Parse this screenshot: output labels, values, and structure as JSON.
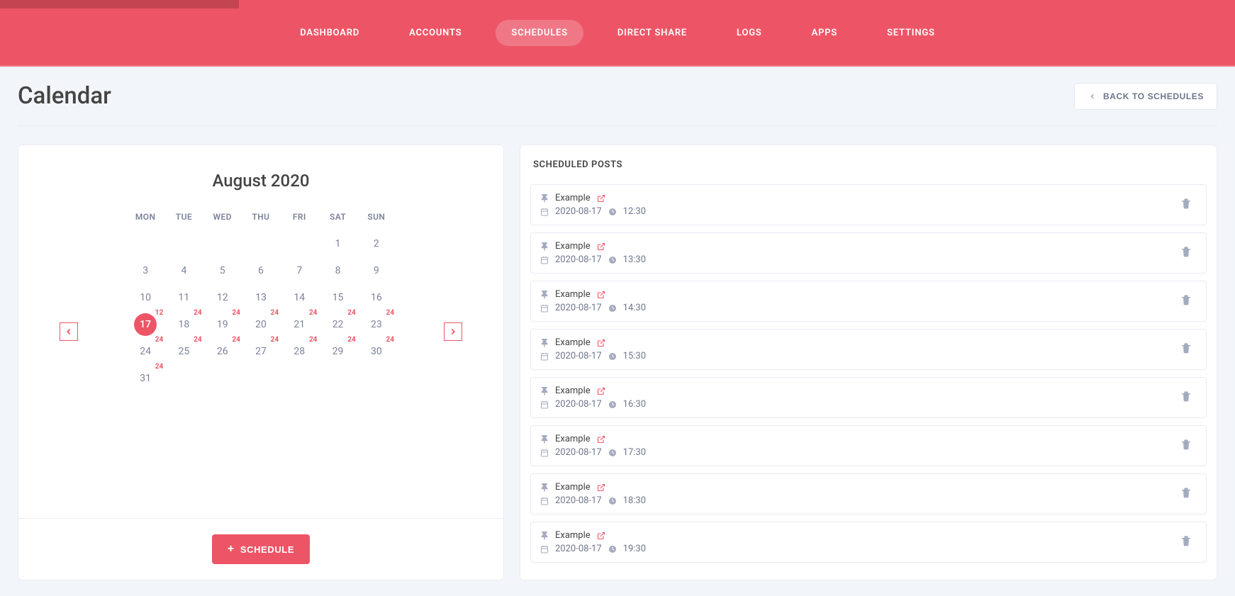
{
  "nav": {
    "items": [
      {
        "label": "DASHBOARD"
      },
      {
        "label": "ACCOUNTS"
      },
      {
        "label": "SCHEDULES",
        "active": true
      },
      {
        "label": "DIRECT SHARE"
      },
      {
        "label": "LOGS"
      },
      {
        "label": "APPS"
      },
      {
        "label": "SETTINGS"
      }
    ]
  },
  "page": {
    "title": "Calendar",
    "back_label": "BACK TO SCHEDULES"
  },
  "calendar": {
    "month_label": "August 2020",
    "dow": [
      "MON",
      "TUE",
      "WED",
      "THU",
      "FRI",
      "SAT",
      "SUN"
    ],
    "weeks": [
      [
        null,
        null,
        null,
        null,
        null,
        {
          "n": "1"
        },
        {
          "n": "2"
        }
      ],
      [
        {
          "n": "3"
        },
        {
          "n": "4"
        },
        {
          "n": "5"
        },
        {
          "n": "6"
        },
        {
          "n": "7"
        },
        {
          "n": "8"
        },
        {
          "n": "9"
        }
      ],
      [
        {
          "n": "10"
        },
        {
          "n": "11"
        },
        {
          "n": "12"
        },
        {
          "n": "13"
        },
        {
          "n": "14"
        },
        {
          "n": "15"
        },
        {
          "n": "16"
        }
      ],
      [
        {
          "n": "17",
          "sel": true,
          "b": "12"
        },
        {
          "n": "18",
          "b": "24"
        },
        {
          "n": "19",
          "b": "24"
        },
        {
          "n": "20",
          "b": "24"
        },
        {
          "n": "21",
          "b": "24"
        },
        {
          "n": "22",
          "b": "24"
        },
        {
          "n": "23",
          "b": "24"
        }
      ],
      [
        {
          "n": "24",
          "b": "24"
        },
        {
          "n": "25",
          "b": "24"
        },
        {
          "n": "26",
          "b": "24"
        },
        {
          "n": "27",
          "b": "24"
        },
        {
          "n": "28",
          "b": "24"
        },
        {
          "n": "29",
          "b": "24"
        },
        {
          "n": "30",
          "b": "24"
        }
      ],
      [
        {
          "n": "31",
          "b": "24"
        },
        null,
        null,
        null,
        null,
        null,
        null
      ]
    ],
    "schedule_btn": "SCHEDULE"
  },
  "posts": {
    "header": "SCHEDULED POSTS",
    "items": [
      {
        "title": "Example",
        "date": "2020-08-17",
        "time": "12:30"
      },
      {
        "title": "Example",
        "date": "2020-08-17",
        "time": "13:30"
      },
      {
        "title": "Example",
        "date": "2020-08-17",
        "time": "14:30"
      },
      {
        "title": "Example",
        "date": "2020-08-17",
        "time": "15:30"
      },
      {
        "title": "Example",
        "date": "2020-08-17",
        "time": "16:30"
      },
      {
        "title": "Example",
        "date": "2020-08-17",
        "time": "17:30"
      },
      {
        "title": "Example",
        "date": "2020-08-17",
        "time": "18:30"
      },
      {
        "title": "Example",
        "date": "2020-08-17",
        "time": "19:30"
      }
    ]
  }
}
